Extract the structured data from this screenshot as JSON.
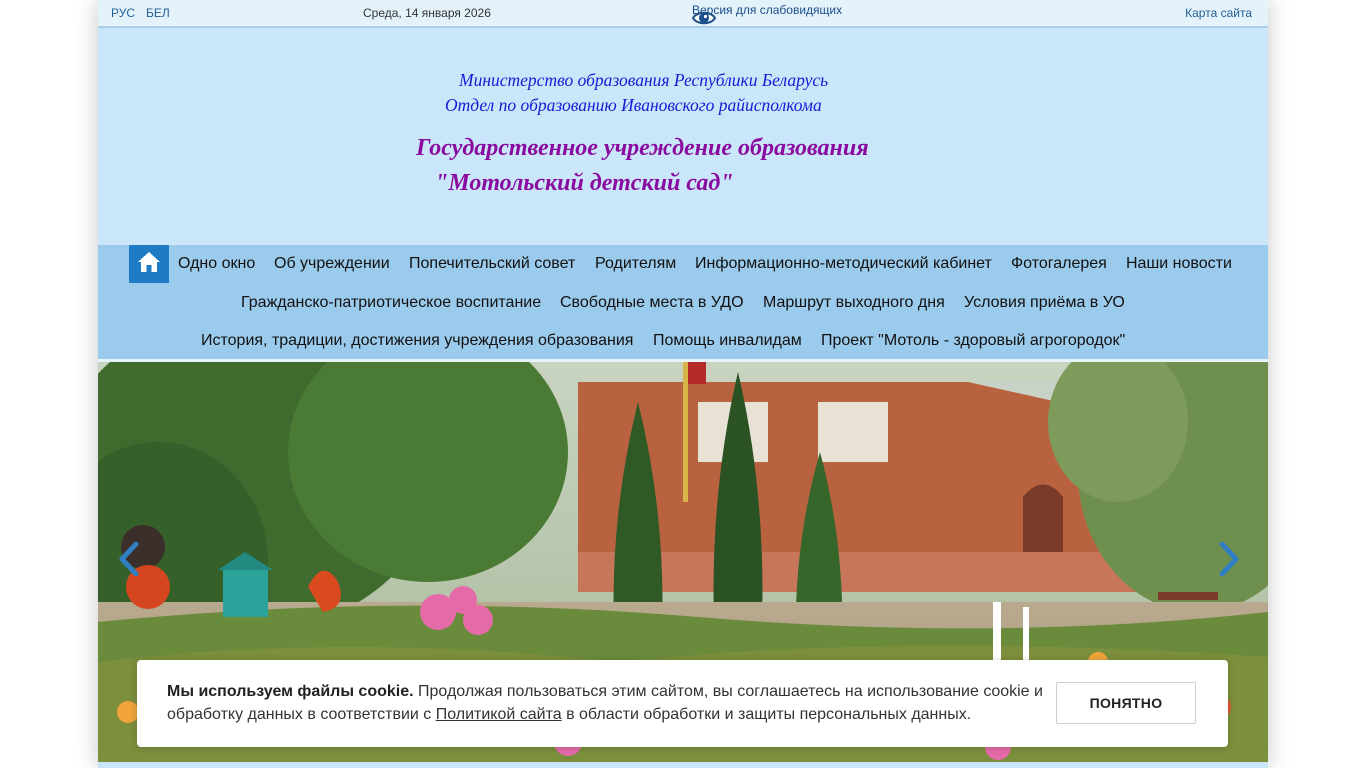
{
  "topbar": {
    "lang_ru": "РУС",
    "lang_be": "БЕЛ",
    "date": "Среда, 14 января 2026",
    "vision_version": "Версия для слабовидящих",
    "sitemap": "Карта сайта"
  },
  "header": {
    "ministry": "Министерство образования Республики Беларусь",
    "department": "Отдел по образованию Ивановского райисполкома",
    "institution_line1": "Государственное учреждение образования",
    "institution_line2": "\"Мотольский детский сад\""
  },
  "nav": {
    "items": [
      "Одно окно",
      "Об учреждении",
      "Попечительский совет",
      "Родителям",
      "Информационно-методический кабинет",
      "Фотогалерея",
      "Наши новости",
      "Гражданско-патриотическое воспитание",
      "Свободные места в УДО",
      "Маршрут выходного дня",
      "Условия приёма в УО",
      "История, традиции, достижения учреждения образования",
      "Помощь инвалидам",
      "Проект \"Мотоль - здоровый агрогородок\""
    ]
  },
  "slider": {
    "prev_icon": "chevron-left-icon",
    "next_icon": "chevron-right-icon"
  },
  "cookie": {
    "bold": "Мы используем файлы cookie.",
    "text1": " Продолжая пользоваться этим сайтом, вы соглашаетесь на использование cookie и обработку данных в соответствии с ",
    "link": "Политикой сайта",
    "text2": " в области обработки и защиты персональных данных.",
    "button": "ПОНЯТНО"
  },
  "colors": {
    "header_bg": "#c9e6fb",
    "nav_bg": "#9bcbec",
    "home_button": "#1e7bc4",
    "ministry_text": "#1a1ad6",
    "institution_text": "#8a0aa0"
  }
}
